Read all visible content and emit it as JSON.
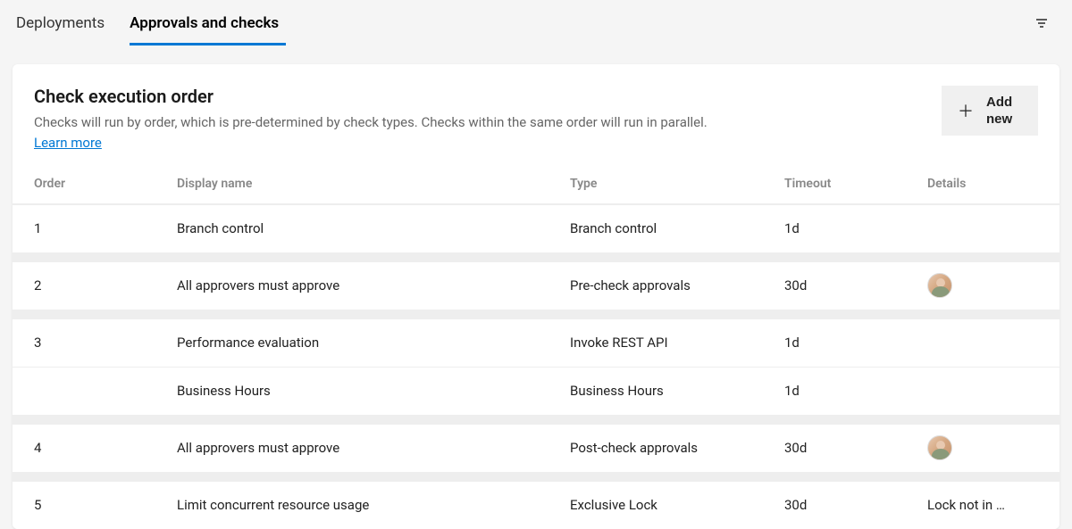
{
  "tabs": {
    "deployments": "Deployments",
    "approvals": "Approvals and checks"
  },
  "card": {
    "title": "Check execution order",
    "description": "Checks will run by order, which is pre-determined by check types. Checks within the same order will run in parallel.",
    "learn_more": "Learn more",
    "add_new": "Add new"
  },
  "columns": {
    "order": "Order",
    "display_name": "Display name",
    "type": "Type",
    "timeout": "Timeout",
    "details": "Details"
  },
  "rows": [
    {
      "order": "1",
      "display_name": "Branch control",
      "type": "Branch control",
      "timeout": "1d",
      "details": "",
      "has_avatar": false
    },
    {
      "order": "2",
      "display_name": "All approvers must approve",
      "type": "Pre-check approvals",
      "timeout": "30d",
      "details": "",
      "has_avatar": true
    },
    {
      "order": "3",
      "display_name": "Performance evaluation",
      "type": "Invoke REST API",
      "timeout": "1d",
      "details": "",
      "has_avatar": false
    },
    {
      "order": "",
      "display_name": "Business Hours",
      "type": "Business Hours",
      "timeout": "1d",
      "details": "",
      "has_avatar": false
    },
    {
      "order": "4",
      "display_name": "All approvers must approve",
      "type": "Post-check approvals",
      "timeout": "30d",
      "details": "",
      "has_avatar": true
    },
    {
      "order": "5",
      "display_name": "Limit concurrent resource usage",
      "type": "Exclusive Lock",
      "timeout": "30d",
      "details": "Lock not in …",
      "has_avatar": false
    }
  ],
  "gaps_after": [
    0,
    1,
    3,
    4
  ]
}
